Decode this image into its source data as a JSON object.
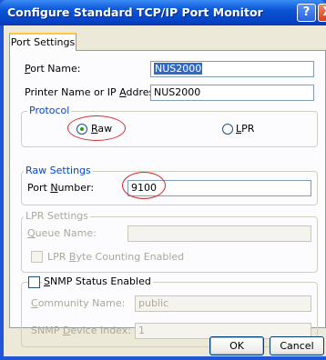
{
  "window": {
    "title": "Configure Standard TCP/IP Port Monitor",
    "help_label": "?",
    "close_label": "X"
  },
  "tab": {
    "label": "Port Settings"
  },
  "fields": {
    "port_name": {
      "label_pre": "",
      "label_acc": "P",
      "label_post": "ort Name:",
      "value": "NUS2000"
    },
    "printer_name": {
      "label_pre": "Printer Name or IP ",
      "label_acc": "A",
      "label_post": "ddress:",
      "value": "NUS2000"
    }
  },
  "protocol": {
    "title": "Protocol",
    "raw": {
      "label_acc": "R",
      "label_post": "aw",
      "selected": true
    },
    "lpr": {
      "label_acc": "L",
      "label_post": "PR",
      "selected": false
    }
  },
  "raw_settings": {
    "title": "Raw Settings",
    "port_number_pre": "Port ",
    "port_number_acc": "N",
    "port_number_post": "umber:",
    "port_number_value": "9100"
  },
  "lpr_settings": {
    "title": "LPR Settings",
    "queue_acc": "Q",
    "queue_post": "ueue Name:",
    "queue_value": "",
    "byte_counting_pre": "LPR ",
    "byte_counting_acc": "B",
    "byte_counting_post": "yte Counting Enabled"
  },
  "snmp": {
    "title_acc": "S",
    "title_post": "NMP Status Enabled",
    "community_acc": "C",
    "community_post": "ommunity Name:",
    "community_value": "public",
    "device_pre": "SNMP ",
    "device_acc": "D",
    "device_post": "evice Index:",
    "device_value": "1"
  },
  "buttons": {
    "ok": "OK",
    "cancel": "Cancel"
  },
  "colors": {
    "titlebar": "#0a54d6",
    "accent_group_title": "#0046d5",
    "annotation_circle": "#d62b2b"
  }
}
